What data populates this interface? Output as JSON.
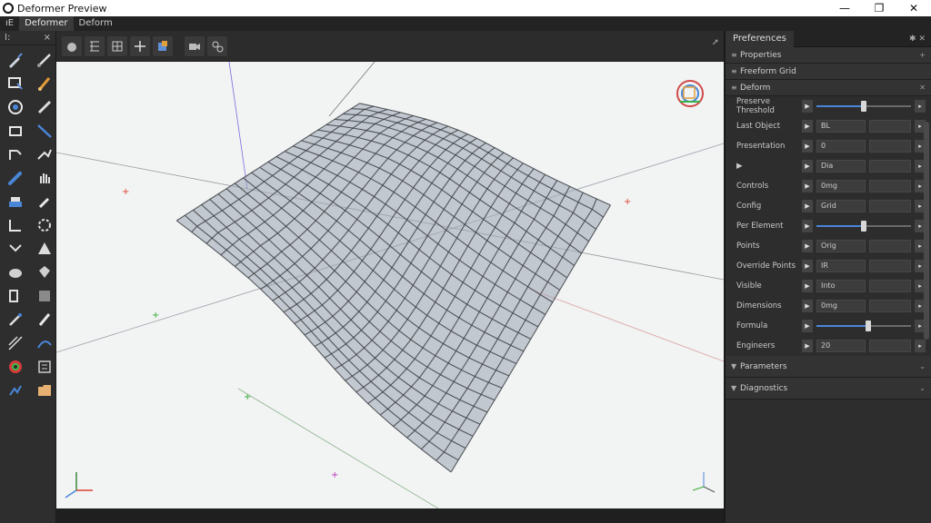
{
  "window": {
    "title": "Deformer Preview",
    "min": "—",
    "max": "❐",
    "close": "✕"
  },
  "menu": [
    "Deformer",
    "Deform"
  ],
  "menu_prefix": "ıE",
  "lefttools": {
    "head_left": "I:",
    "head_right": "⨯"
  },
  "panel": {
    "tab": "Preferences",
    "sections_top": [
      {
        "label": "Properties",
        "right": "+"
      },
      {
        "label": "Freeform Grid"
      },
      {
        "label": "Deform",
        "right": "✕"
      }
    ],
    "rows": [
      {
        "label": "Preserve Threshold",
        "type": "slider",
        "value": 0.5
      },
      {
        "label": "Last Object",
        "type": "field",
        "value": "BL"
      },
      {
        "label": "Presentation",
        "type": "field",
        "value": "0"
      },
      {
        "label": "▶",
        "type": "field",
        "value": "Dia"
      },
      {
        "label": "Controls",
        "type": "field",
        "value": "0mg"
      },
      {
        "label": "Config",
        "type": "field",
        "value": "Grid"
      },
      {
        "label": "Per Element",
        "type": "slider",
        "value": 0.5
      },
      {
        "label": "Points",
        "type": "field",
        "value": "Orig"
      },
      {
        "label": "Override Points",
        "type": "field",
        "value": "IR"
      },
      {
        "label": "Visible",
        "type": "field",
        "value": "Into"
      },
      {
        "label": "Dimensions",
        "type": "field",
        "value": "0mg"
      },
      {
        "label": "Formula",
        "type": "slider",
        "value": 0.55
      },
      {
        "label": "Engineers",
        "type": "field",
        "value": "20"
      }
    ],
    "sections_bottom": [
      {
        "label": "Parameters"
      },
      {
        "label": "Diagnostics"
      }
    ]
  },
  "colors": {
    "accent": "#4a86d8",
    "viewport_bg": "#f2f3f3",
    "mesh": "#3c3f44"
  }
}
